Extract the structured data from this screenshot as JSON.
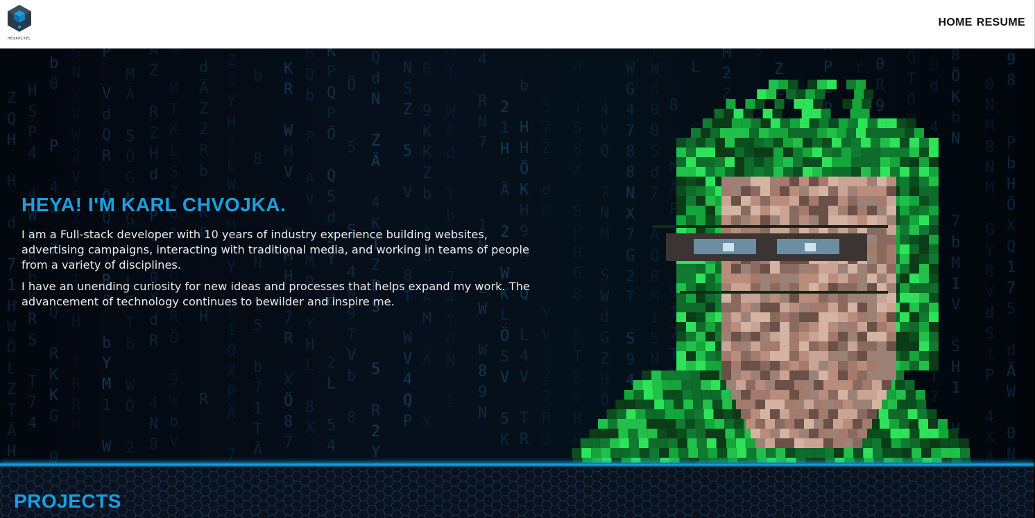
{
  "logo": {
    "text": "HEXAPIXEL"
  },
  "nav": {
    "home": "HOME",
    "resume": "RESUME"
  },
  "hero": {
    "title": "HEYA! I'M KARL CHVOJKA.",
    "paragraph_1": "I am a Full-stack developer with 10 years of industry experience building websites, advertising campaigns, interacting with traditional media, and working in teams of people from a variety of disciplines.",
    "paragraph_2": "I have an unending curiosity for new ideas and processes that helps expand my work. The advancement of technology continues to bewilder and inspire me."
  },
  "projects": {
    "title": "PROJECTS"
  },
  "colors": {
    "accent": "#1aa0e0",
    "header_bg": "#ffffff",
    "hero_bg": "#050b14",
    "portrait_green": "#22c04a"
  },
  "icons": {
    "logo": "hexagon-logo-icon",
    "portrait": "pixelated-portrait-image"
  }
}
